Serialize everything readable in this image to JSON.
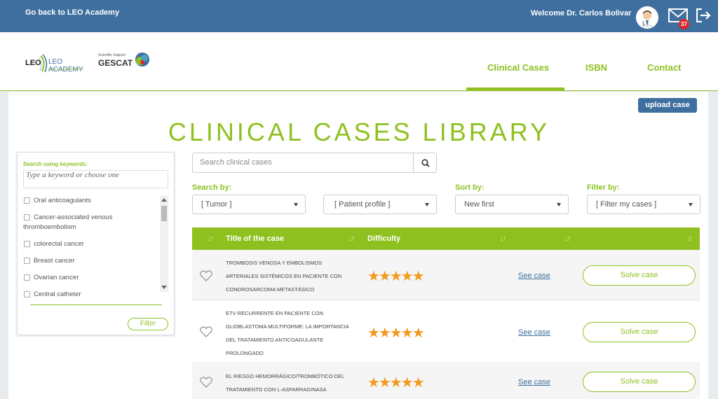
{
  "topbar": {
    "back_link": "Go back to LEO Academy",
    "welcome": "Welcome Dr. Carlos Bolivar",
    "mail_count": "37",
    "icons": [
      "avatar-icon",
      "mail-icon",
      "logout-icon"
    ]
  },
  "logos": {
    "leo": "LEO ACADEMY",
    "leo_sub": "CLINICAL CASES LIBRARY",
    "gescat_top": "Scientific Support",
    "gescat": "GESCAT"
  },
  "nav": {
    "items": [
      "Clinical Cases",
      "ISBN",
      "Contact"
    ],
    "active": "Clinical Cases"
  },
  "upload_label": "upload case",
  "page_title": "CLINICAL CASES LIBRARY",
  "sidebar": {
    "label": "Search using keywords:",
    "placeholder": "Type a keyword or choose one",
    "keywords": [
      "Oral anticoagulants",
      "Cancer-associated venous thromboembolism",
      "colorectal cancer",
      "Breast cancer",
      "Ovarian cancer",
      "Central catheter"
    ],
    "filter_label": "Filter"
  },
  "search": {
    "placeholder": "Search clinical cases"
  },
  "filters": {
    "search_by_label": "Search by:",
    "sort_by_label": "Sort by:",
    "filter_by_label": "Filter by:",
    "tumor": "[ Tumor ]",
    "patient_profile": "[ Patient profile ]",
    "sort": "New first",
    "filter": "[ Filter my cases ]"
  },
  "table": {
    "headers": [
      "Title of the case",
      "Difficulty"
    ],
    "see_case_label": "See case",
    "solve_case_label": "Solve case",
    "rows": [
      {
        "title_lines": [
          "TROMBOSIS VENOSA Y EMBOLISMOS",
          "ARTERIALES SISTÉMICOS EN PACIENTE CON",
          "CONDROSARCOMA METASTÁSICO"
        ],
        "difficulty": 5,
        "stars": "★★★★★"
      },
      {
        "title_lines": [
          "ETV RECURRENTE EN PACIENTE CON",
          "GLIOBLASTOMA MULTIFORME: LA IMPORTANCIA",
          "DEL TRATAMIENTO ANTICOAGULANTE",
          "PROLONGADO"
        ],
        "difficulty": 5,
        "stars": "★★★★★"
      },
      {
        "title_lines": [
          "EL RIESGO HEMORRÁGICO/TROMBÓTICO DEL",
          "TRATAMIENTO CON L-ASPARRAGINASA"
        ],
        "difficulty": 5,
        "stars": "★★★★★"
      }
    ]
  },
  "colors": {
    "accent": "#8ec11f",
    "primary": "#3e6f9e",
    "star": "#f39a1e"
  }
}
